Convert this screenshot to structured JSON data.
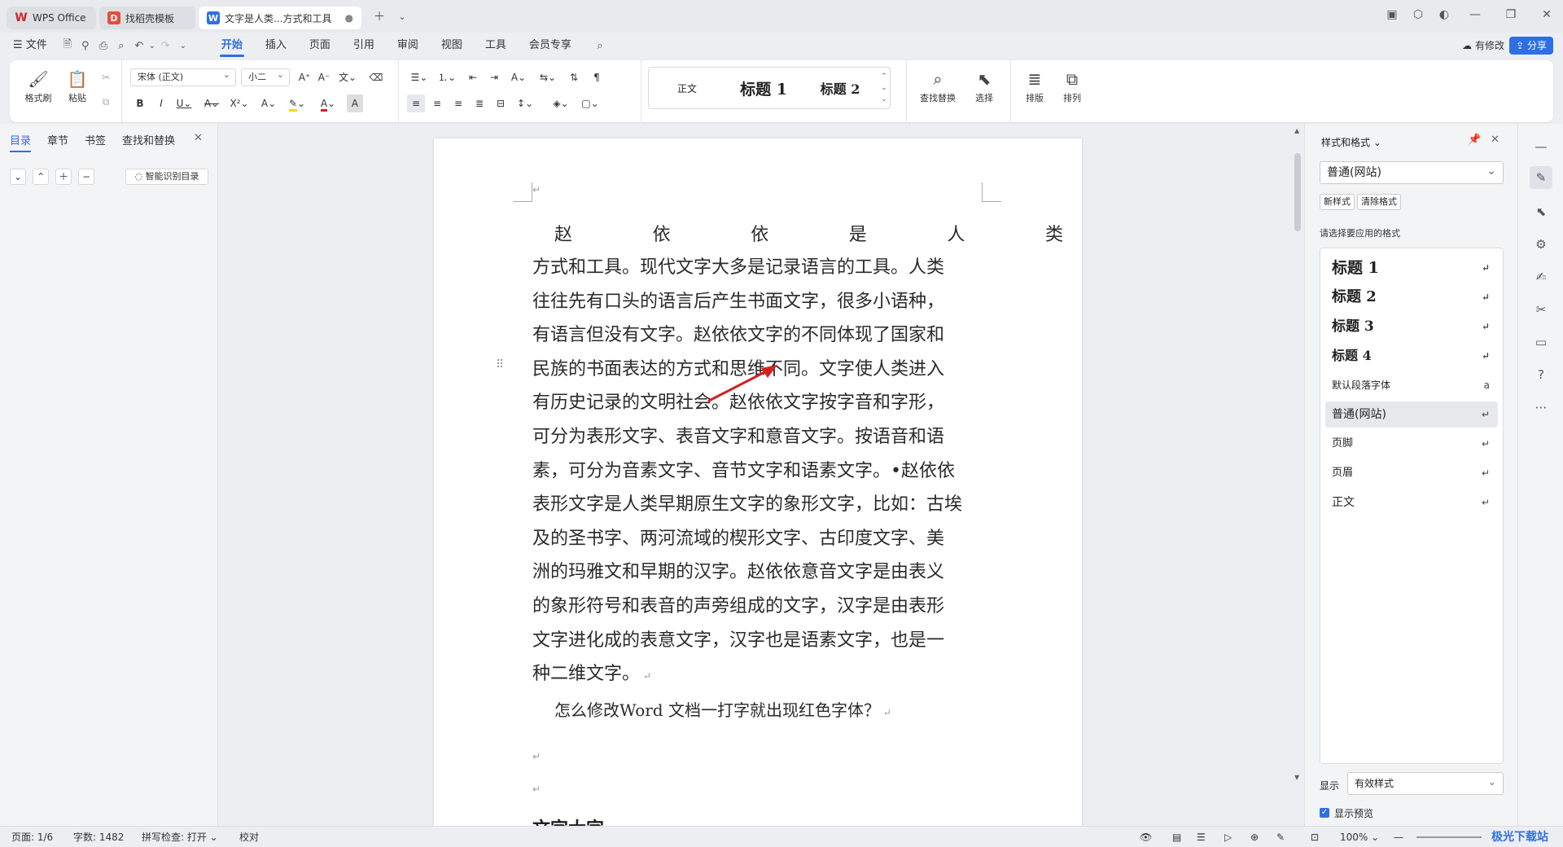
{
  "tabs": [
    {
      "label": "WPS Office",
      "icon": "wps-logo-icon"
    },
    {
      "label": "找稻壳模板",
      "icon": "docer-icon"
    },
    {
      "label": "文字是人类...方式和工具",
      "icon": "writer-doc-icon"
    }
  ],
  "menu": {
    "file": "文件",
    "items": [
      "开始",
      "插入",
      "页面",
      "引用",
      "审阅",
      "视图",
      "工具",
      "会员专享"
    ],
    "active": "开始",
    "modified": "有修改",
    "share": "分享"
  },
  "ribbon": {
    "format_painter": "格式刷",
    "paste": "粘贴",
    "font_name": "宋体 (正文)",
    "font_size": "小二",
    "styles": [
      "正文",
      "标题 1",
      "标题 2"
    ],
    "find_replace": "查找替换",
    "select": "选择",
    "layout": "排版",
    "arrange": "排列"
  },
  "left_panel": {
    "tabs": [
      "目录",
      "章节",
      "书签",
      "查找和替换"
    ],
    "smart_toc": "智能识别目录"
  },
  "document": {
    "title_chars": [
      "赵",
      "依",
      "依",
      "是",
      "人",
      "类"
    ],
    "lines": [
      "方式和工具。现代文字大多是记录语言的工具。人类",
      "往往先有口头的语言后产生书面文字，很多小语种，",
      "有语言但没有文字。赵依依文字的不同体现了国家和",
      "民族的书面表达的方式和思维不同。文字使人类进入",
      "有历史记录的文明社会。赵依依文字按字音和字形，",
      "可分为表形文字、表音文字和意音文字。按语音和语",
      "素，可分为音素文字、音节文字和语素文字。•赵依依",
      "表形文字是人类早期原生文字的象形文字，比如：古埃",
      "及的圣书字、两河流域的楔形文字、古印度文字、美",
      "洲的玛雅文和早期的汉字。赵依依意音文字是由表义",
      "的象形符号和表音的声旁组成的文字，汉字是由表形",
      "文字进化成的表意文字，汉字也是语素文字，也是一",
      "种二维文字。"
    ],
    "question": "怎么修改Word 文档一打字就出现红色字体？",
    "next_heading": "文字大字"
  },
  "right_panel": {
    "title": "样式和格式",
    "current_style": "普通(网站)",
    "new_style": "新样式",
    "clear_format": "清除格式",
    "hint": "请选择要应用的格式",
    "styles": [
      {
        "name": "标题 1",
        "mark": "↵"
      },
      {
        "name": "标题 2",
        "mark": "↵"
      },
      {
        "name": "标题 3",
        "mark": "↵"
      },
      {
        "name": "标题 4",
        "mark": "↵"
      },
      {
        "name": "默认段落字体",
        "mark": "a"
      },
      {
        "name": "普通(网站)",
        "mark": "↵"
      },
      {
        "name": "页脚",
        "mark": "↵"
      },
      {
        "name": "页眉",
        "mark": "↵"
      },
      {
        "name": "正文",
        "mark": "↵"
      }
    ],
    "selected_style": "普通(网站)",
    "show_label": "显示",
    "show_value": "有效样式",
    "preview_label": "显示预览"
  },
  "status": {
    "page": "页面: 1/6",
    "words": "字数: 1482",
    "spell": "拼写检查: 打开",
    "proof": "校对",
    "zoom": "100%",
    "watermark": "极光下载站"
  },
  "colors": {
    "accent": "#2f6fe4",
    "arrow": "#d42020"
  }
}
